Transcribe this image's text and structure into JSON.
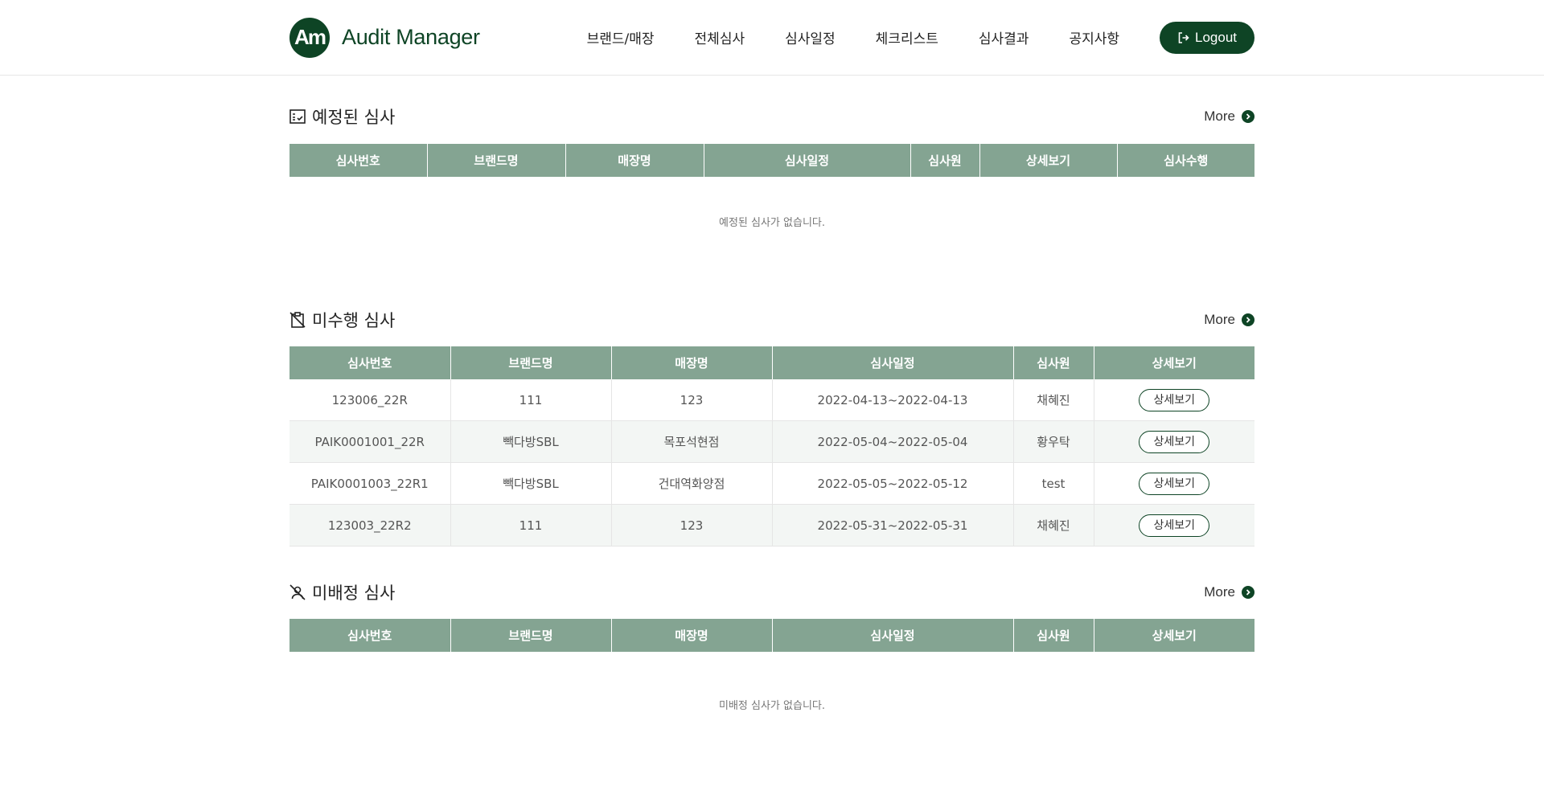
{
  "app": {
    "logo_mark": "Am",
    "logo_text": "Audit Manager"
  },
  "nav": {
    "items": [
      {
        "label": "브랜드/매장"
      },
      {
        "label": "전체심사"
      },
      {
        "label": "심사일정"
      },
      {
        "label": "체크리스트"
      },
      {
        "label": "심사결과"
      },
      {
        "label": "공지사항"
      }
    ],
    "logout_label": "Logout"
  },
  "scheduled": {
    "title": "예정된 심사",
    "more_label": "More",
    "columns": [
      "심사번호",
      "브랜드명",
      "매장명",
      "심사일정",
      "심사원",
      "상세보기",
      "심사수행"
    ],
    "empty_text": "예정된 심사가 없습니다."
  },
  "unperformed": {
    "title": "미수행 심사",
    "more_label": "More",
    "columns": [
      "심사번호",
      "브랜드명",
      "매장명",
      "심사일정",
      "심사원",
      "상세보기"
    ],
    "rows": [
      {
        "id": "123006_22R",
        "brand": "111",
        "store": "123",
        "schedule": "2022-04-13~2022-04-13",
        "auditor": "채혜진",
        "detail": "상세보기"
      },
      {
        "id": "PAIK0001001_22R",
        "brand": "빽다방SBL",
        "store": "목포석현점",
        "schedule": "2022-05-04~2022-05-04",
        "auditor": "황우탁",
        "detail": "상세보기"
      },
      {
        "id": "PAIK0001003_22R1",
        "brand": "빽다방SBL",
        "store": "건대역화양점",
        "schedule": "2022-05-05~2022-05-12",
        "auditor": "test",
        "detail": "상세보기"
      },
      {
        "id": "123003_22R2",
        "brand": "111",
        "store": "123",
        "schedule": "2022-05-31~2022-05-31",
        "auditor": "채혜진",
        "detail": "상세보기"
      }
    ]
  },
  "unassigned": {
    "title": "미배정 심사",
    "more_label": "More",
    "columns": [
      "심사번호",
      "브랜드명",
      "매장명",
      "심사일정",
      "심사원",
      "상세보기"
    ],
    "empty_text": "미배정 심사가 없습니다."
  },
  "colors": {
    "brand": "#0e4425",
    "table_header": "#84a492",
    "row_alt": "#f3f6f4"
  }
}
